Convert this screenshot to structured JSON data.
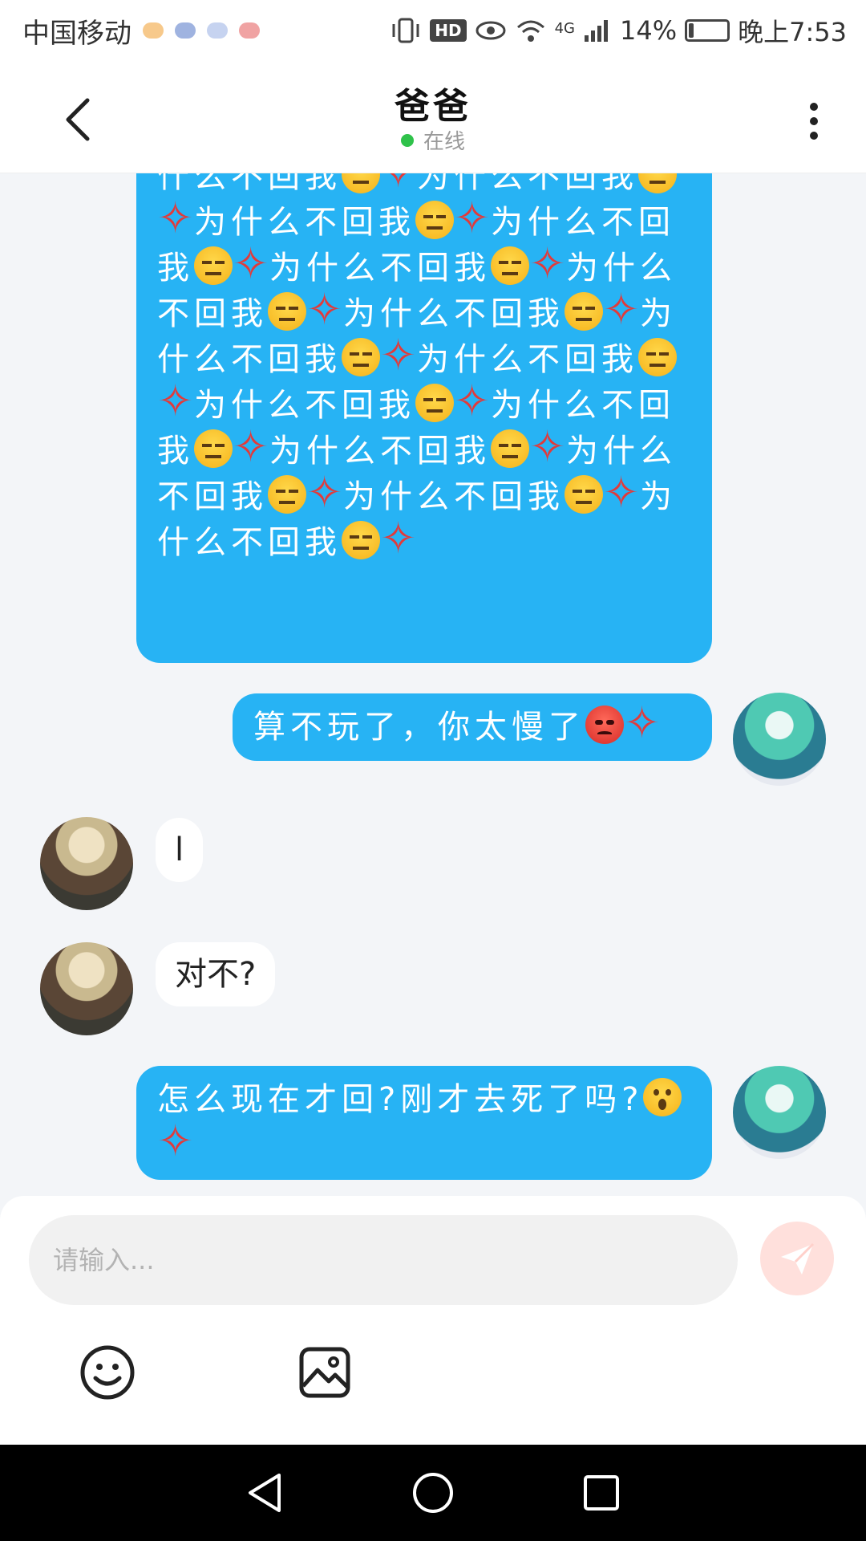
{
  "status_bar": {
    "carrier": "中国移动",
    "hd": "HD",
    "network": "4G",
    "battery": "14%",
    "battery_level": 0.14,
    "time": "晚上7:53"
  },
  "header": {
    "title": "爸爸",
    "status": "在线",
    "status_color": "#2fc24a"
  },
  "messages": [
    {
      "from": "me",
      "text": "什么不回我😑💢为什么不回我😑💢为什么不回我😑💢为什么不回我😑💢为什么不回我😑💢为什么不回我😑💢为什么不回我😑💢为什么不回我😑💢为什么不回我😑💢为什么不回我😑💢为什么不回我😑💢为什么不回我😑💢为什么不回我😑💢为什么不回我😑💢为什么不回我😑💢"
    },
    {
      "from": "me",
      "text": "算不玩了，你太慢了😡💢"
    },
    {
      "from": "dad",
      "text": "l"
    },
    {
      "from": "dad",
      "text": "对不?"
    },
    {
      "from": "me",
      "text": "怎么现在才回?刚才去死了吗?😮💢"
    }
  ],
  "composer": {
    "placeholder": "请输入..."
  },
  "icons": {
    "back": "chevron-left-icon",
    "more": "more-vertical-icon",
    "send": "send-icon",
    "emoji": "emoji-icon",
    "image": "image-icon"
  },
  "colors": {
    "bubble_me": "#27b3f4",
    "bubble_other": "#ffffff",
    "send_disabled": "#ffe0dc"
  }
}
